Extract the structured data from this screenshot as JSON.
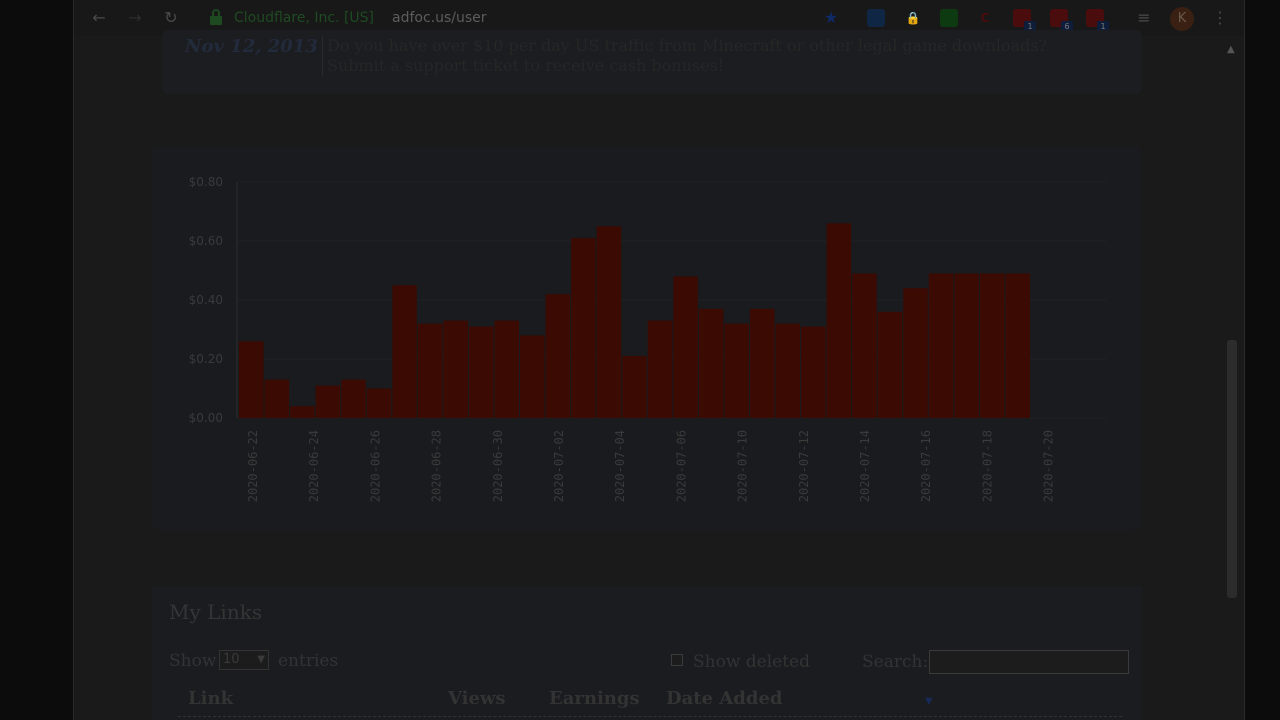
{
  "browser": {
    "site_identity": "Cloudflare, Inc. [US]",
    "url": "adfoc.us/user",
    "profile_initial": "K",
    "extension_badges": [
      "1",
      "6",
      "1"
    ]
  },
  "notice": {
    "date": "Nov 12, 2013",
    "line1": "Do you have over $10 per day US traffic from Minecraft or other legal game downloads?",
    "line2": "Submit a support ticket to receive cash bonuses!"
  },
  "chart_data": {
    "type": "bar",
    "bar_color": "#3a0a03",
    "ylim": [
      0,
      0.8
    ],
    "y_ticks": [
      "$0.00",
      "$0.20",
      "$0.40",
      "$0.60",
      "$0.80"
    ],
    "x_tick_labels": [
      "2020-06-22",
      "2020-06-24",
      "2020-06-26",
      "2020-06-28",
      "2020-06-30",
      "2020-07-02",
      "2020-07-04",
      "2020-07-06",
      "2020-07-10",
      "2020-07-12",
      "2020-07-14",
      "2020-07-16",
      "2020-07-18",
      "2020-07-20"
    ],
    "categories": [
      "2020-06-22",
      "2020-06-23",
      "2020-06-24",
      "2020-06-25",
      "2020-06-26",
      "2020-06-27",
      "2020-06-28",
      "2020-06-29",
      "2020-06-30",
      "2020-07-01",
      "2020-07-02",
      "2020-07-03",
      "2020-07-04",
      "2020-07-05",
      "2020-07-06",
      "2020-07-07",
      "2020-07-08",
      "2020-07-09",
      "2020-07-10",
      "2020-07-11",
      "2020-07-12",
      "2020-07-13",
      "2020-07-14",
      "2020-07-15",
      "2020-07-16",
      "2020-07-17",
      "2020-07-18",
      "2020-07-19",
      "2020-07-20",
      "2020-07-21",
      "2020-07-22"
    ],
    "values": [
      0.26,
      0.13,
      0.04,
      0.11,
      0.13,
      0.1,
      0.45,
      0.32,
      0.33,
      0.31,
      0.33,
      0.28,
      0.42,
      0.61,
      0.65,
      0.21,
      0.33,
      0.48,
      0.37,
      0.32,
      0.37,
      0.32,
      0.31,
      0.66,
      0.49,
      0.36,
      0.44,
      0.49,
      0.49,
      0.49,
      0.49
    ]
  },
  "links": {
    "title": "My Links",
    "show_label": "Show",
    "page_size": "10",
    "entries_label": "entries",
    "show_deleted_label": "Show deleted",
    "search_label": "Search:",
    "columns": [
      "Link",
      "Views",
      "Earnings",
      "Date Added"
    ]
  }
}
